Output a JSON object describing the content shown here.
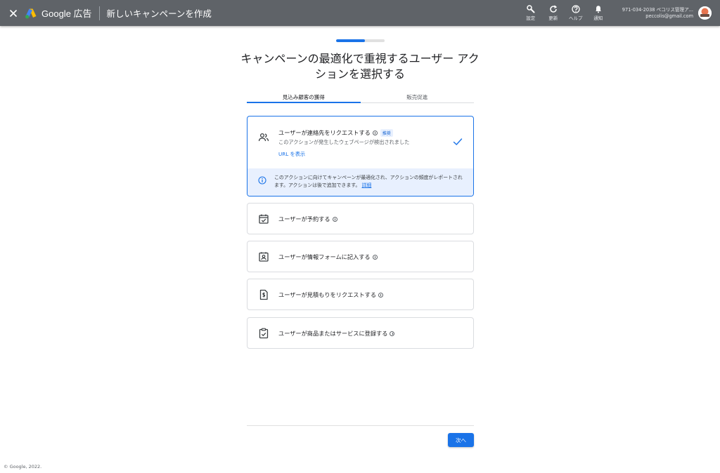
{
  "topbar": {
    "brand": "Google 広告",
    "page_heading": "新しいキャンペーンを作成",
    "actions": [
      {
        "icon": "wrench-icon",
        "label": "設定"
      },
      {
        "icon": "refresh-icon",
        "label": "更新"
      },
      {
        "icon": "help-icon",
        "label": "ヘルプ"
      },
      {
        "icon": "bell-icon",
        "label": "通知"
      }
    ],
    "account_id": "971-034-2038 ペコリス管理ア...",
    "account_email": "peccolis@gmail.com"
  },
  "progress": {
    "fraction": 0.6
  },
  "main": {
    "title": "キャンペーンの最適化で重視するユーザー アクションを選択する",
    "tabs": [
      {
        "label": "見込み顧客の獲得",
        "active": true
      },
      {
        "label": "販売促進",
        "active": false
      }
    ],
    "selected_option": {
      "label": "ユーザーが連絡先をリクエストする",
      "badge": "推奨",
      "description": "このアクションが発生したウェブページが検出されました",
      "link": "URL を表示",
      "note": "このアクションに向けてキャンペーンが最適化され、アクションの頻度がレポートされます。アクションは後で追加できます。",
      "note_link": "詳細"
    },
    "options": [
      {
        "label": "ユーザーが予約する",
        "icon": "calendar-check-icon"
      },
      {
        "label": "ユーザーが情報フォームに記入する",
        "icon": "contact-form-icon"
      },
      {
        "label": "ユーザーが見積もりをリクエストする",
        "icon": "quote-document-icon"
      },
      {
        "label": "ユーザーが商品またはサービスに登録する",
        "icon": "clipboard-check-icon"
      }
    ]
  },
  "footer": {
    "next_label": "次へ",
    "copyright": "© Google, 2022."
  },
  "colors": {
    "topbar": "#5f6368",
    "accent": "#1a73e8",
    "note_bg": "#e8f0fe"
  }
}
